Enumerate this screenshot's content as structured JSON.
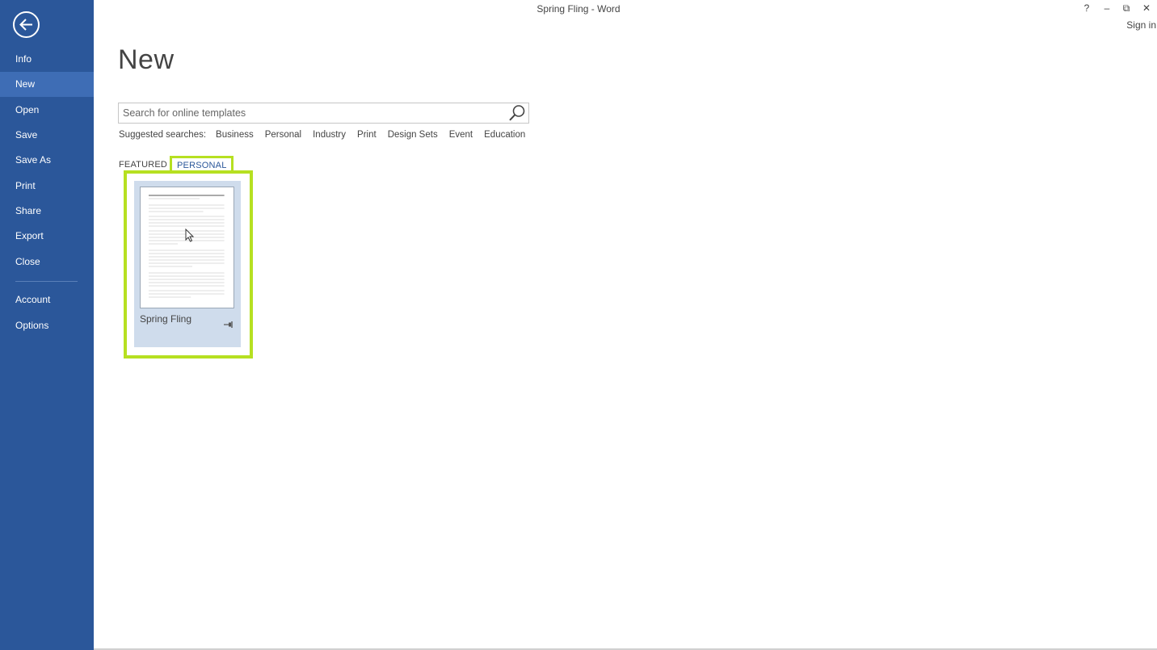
{
  "window": {
    "title": "Spring Fling - Word",
    "help": "?",
    "minimize": "–",
    "restore": "⧉",
    "close": "✕",
    "sign_in": "Sign in"
  },
  "sidebar": {
    "items": [
      {
        "label": "Info"
      },
      {
        "label": "New"
      },
      {
        "label": "Open"
      },
      {
        "label": "Save"
      },
      {
        "label": "Save As"
      },
      {
        "label": "Print"
      },
      {
        "label": "Share"
      },
      {
        "label": "Export"
      },
      {
        "label": "Close"
      },
      {
        "label": "Account"
      },
      {
        "label": "Options"
      }
    ],
    "active": "New"
  },
  "main": {
    "title": "New",
    "search": {
      "placeholder": "Search for online templates",
      "value": ""
    },
    "suggested_label": "Suggested searches:",
    "suggested": [
      "Business",
      "Personal",
      "Industry",
      "Print",
      "Design Sets",
      "Event",
      "Education"
    ],
    "tabs": [
      {
        "label": "FEATURED"
      },
      {
        "label": "PERSONAL"
      }
    ],
    "selected_tab": "PERSONAL",
    "templates": [
      {
        "name": "Spring Fling"
      }
    ]
  },
  "colors": {
    "accent": "#2b579a",
    "highlight": "#b6e021",
    "tile_bg": "#cfdcec"
  },
  "icons": {
    "back": "back-arrow-icon",
    "search": "search-icon",
    "pin": "pin-icon"
  }
}
